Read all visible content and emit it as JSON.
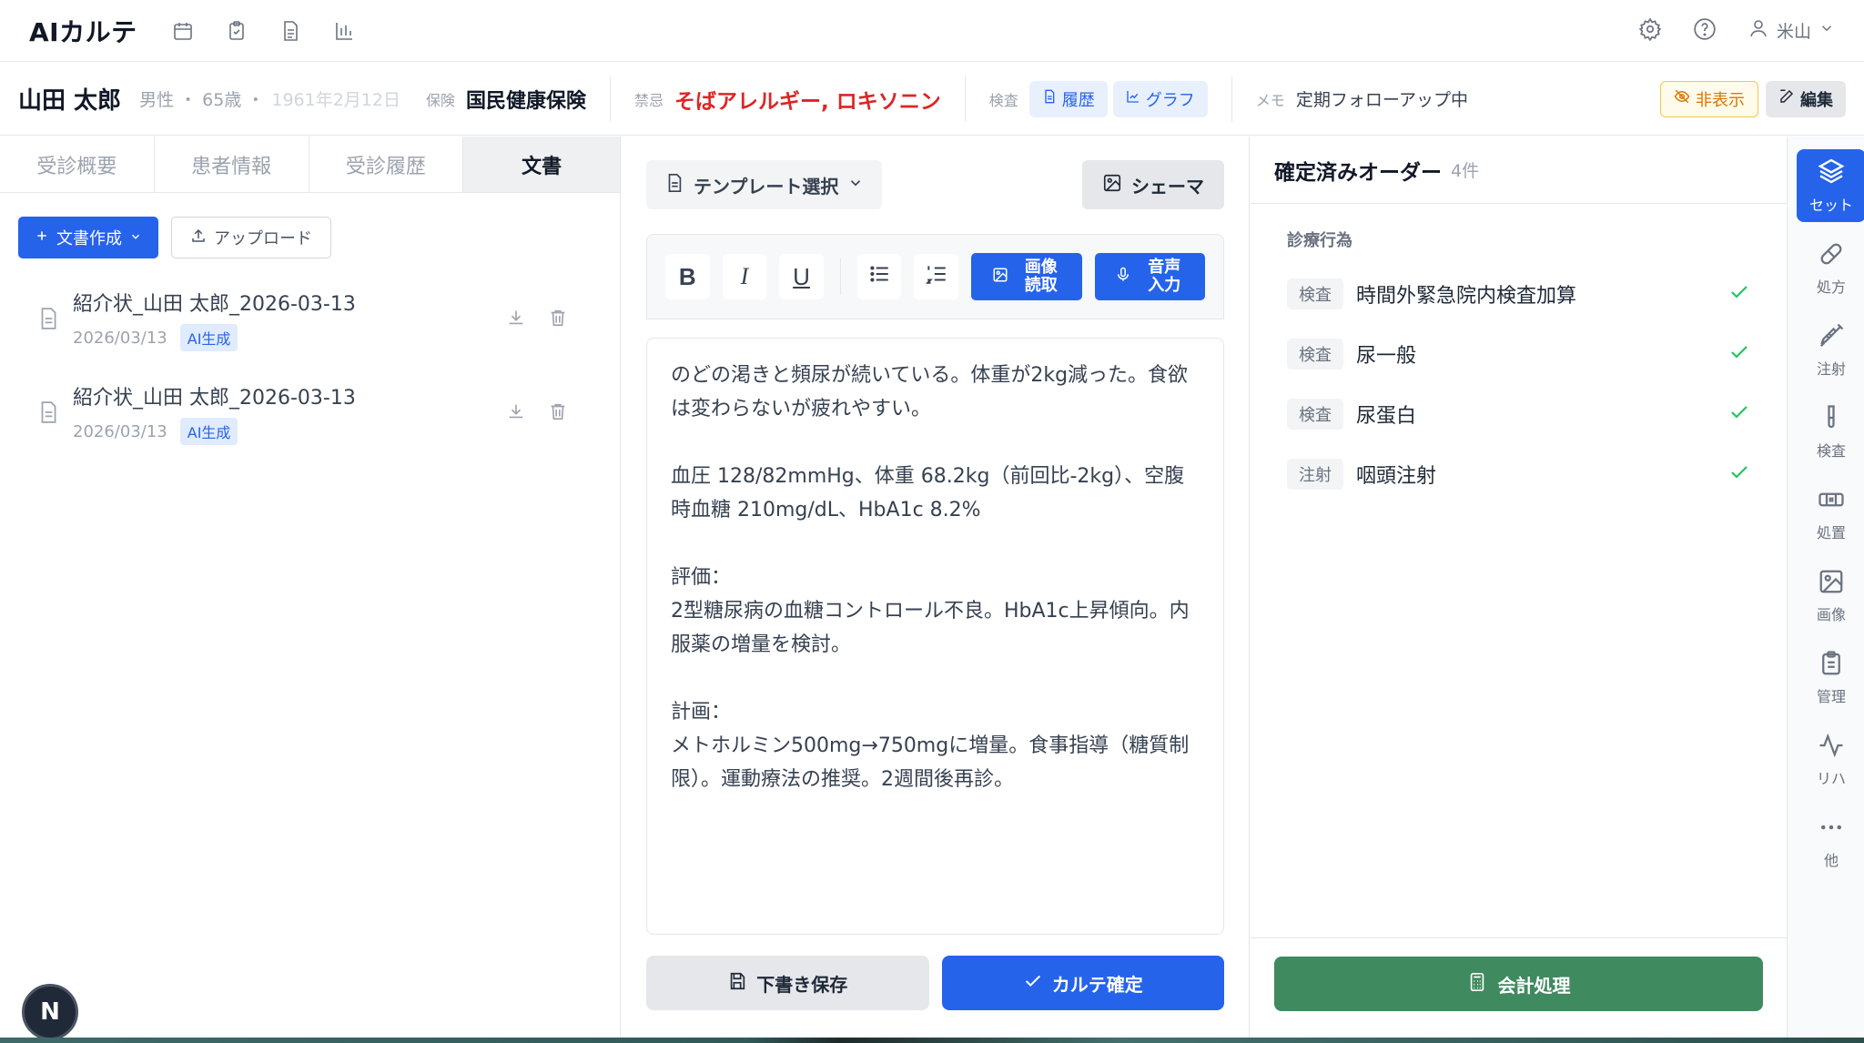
{
  "app": {
    "title": "AIカルテ",
    "user": "米山"
  },
  "patient": {
    "name": "山田 太郎",
    "gender_age": "男性 ・ 65歳 ・",
    "dob": "1961年2月12日",
    "insurance_label": "保険",
    "insurance": "国民健康保険",
    "allergy_label": "禁忌",
    "allergy": "そばアレルギー, ロキソニン",
    "exam_label": "検査",
    "history_btn": "履歴",
    "graph_btn": "グラフ",
    "memo_label": "メモ",
    "memo": "定期フォローアップ中",
    "hide_btn": "非表示",
    "edit_btn": "編集"
  },
  "left": {
    "tabs": [
      "受診概要",
      "患者情報",
      "受診履歴",
      "文書"
    ],
    "create_btn": "文書作成",
    "upload_btn": "アップロード",
    "documents": [
      {
        "title": "紹介状_山田 太郎_2026-03-13",
        "date": "2026/03/13",
        "badge": "AI生成"
      },
      {
        "title": "紹介状_山田 太郎_2026-03-13",
        "date": "2026/03/13",
        "badge": "AI生成"
      }
    ],
    "fab": "N"
  },
  "editor": {
    "template_btn": "テンプレート選択",
    "schema_btn": "シェーマ",
    "toolbar": {
      "bold": "B",
      "italic": "I",
      "underline": "U",
      "image_read": "画像読取",
      "voice_input": "音声入力"
    },
    "content": "のどの渇きと頻尿が続いている。体重が2kg減った。食欲は変わらないが疲れやすい。\n\n血圧 128/82mmHg、体重 68.2kg（前回比-2kg）、空腹時血糖 210mg/dL、HbA1c 8.2%\n\n評価：\n2型糖尿病の血糖コントロール不良。HbA1c上昇傾向。内服薬の増量を検討。\n\n計画：\nメトホルミン500mg→750mgに増量。食事指導（糖質制限）。運動療法の推奨。2週間後再診。",
    "draft_btn": "下書き保存",
    "confirm_btn": "カルテ確定"
  },
  "orders": {
    "title": "確定済みオーダー",
    "count": "4件",
    "section": "診療行為",
    "items": [
      {
        "tag": "検査",
        "name": "時間外緊急院内検査加算"
      },
      {
        "tag": "検査",
        "name": "尿一般"
      },
      {
        "tag": "検査",
        "name": "尿蛋白"
      },
      {
        "tag": "注射",
        "name": "咽頭注射"
      }
    ],
    "billing_btn": "会計処理"
  },
  "rail": [
    "セット",
    "処方",
    "注射",
    "検査",
    "処置",
    "画像",
    "管理",
    "リハ",
    "他"
  ],
  "colors": {
    "accent": "#2563eb",
    "danger": "#dc2626",
    "success": "#3f8a5e",
    "warning": "#d97706"
  }
}
